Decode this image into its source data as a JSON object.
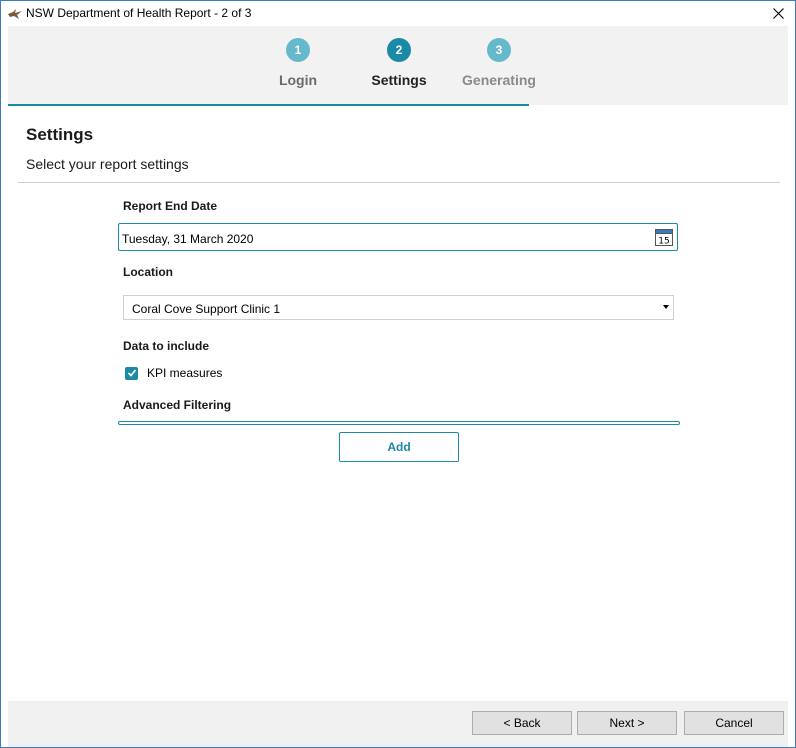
{
  "window": {
    "title": "NSW Department of Health Report - 2 of 3"
  },
  "stepper": {
    "steps": [
      {
        "number": "1",
        "label": "Login",
        "state": "done"
      },
      {
        "number": "2",
        "label": "Settings",
        "state": "active"
      },
      {
        "number": "3",
        "label": "Generating",
        "state": "todo"
      }
    ]
  },
  "header": {
    "title": "Settings",
    "subtitle": "Select your report settings"
  },
  "form": {
    "report_end_date": {
      "label": "Report End Date",
      "value": "Tuesday, 31 March 2020",
      "calendar_day": "15"
    },
    "location": {
      "label": "Location",
      "value": "Coral Cove Support Clinic 1"
    },
    "data_to_include": {
      "label": "Data to include",
      "kpi_label": "KPI measures",
      "kpi_checked": true
    },
    "advanced_filtering": {
      "label": "Advanced Filtering",
      "add_label": "Add"
    }
  },
  "footer": {
    "back_label": "< Back",
    "next_label": "Next >",
    "cancel_label": "Cancel"
  },
  "colors": {
    "accent": "#1a8aa6",
    "accent_light": "#66b9cc",
    "stepper_bg": "#f2f2f2"
  }
}
